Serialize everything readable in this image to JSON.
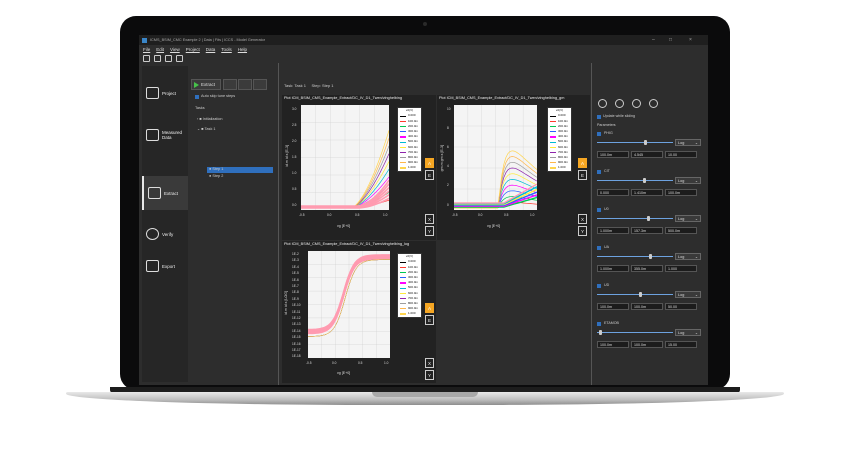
{
  "window": {
    "title": "ICMS_BSIM_CMC Example 2 | Data | Fits | ICCS - Model Generator"
  },
  "menu": [
    "File",
    "Edit",
    "View",
    "Project",
    "Data",
    "Tools",
    "Help"
  ],
  "nav": [
    {
      "label": "Project",
      "icon": "project-icon"
    },
    {
      "label": "Measured Data",
      "icon": "table-icon"
    },
    {
      "label": "Extract",
      "icon": "extract-icon"
    },
    {
      "label": "Verify",
      "icon": "check-circle-icon"
    },
    {
      "label": "Export",
      "icon": "export-table-icon"
    }
  ],
  "tasks_panel": {
    "extract_label": "Extract",
    "auto_skip": "Auto skip tune steps",
    "tasks_header": "Tasks",
    "items": [
      "Initialization",
      "Task 1",
      "Step 1",
      "Step 2"
    ]
  },
  "breadcrumb": {
    "task": "Task: Task 1",
    "step": "Step: Step 1"
  },
  "plots": [
    {
      "title": "Plot ICM_BSIM_CMS_Example_Extract/DC_IV_D1_Twen/vlnghelbing",
      "ylabel": "id.m id.s [E-3]",
      "xlabel": "vg [E+0]",
      "yticks": [
        "3.0",
        "2.5",
        "2.0",
        "1.5",
        "1.0",
        "0.5",
        "0.0"
      ],
      "xticks": [
        "-0.5",
        "0.0",
        "0.5",
        "1.0"
      ]
    },
    {
      "title": "Plot ICM_BSIM_CMS_Example_Extract/DC_IV_D1_Twen/vlnghelbing_gm",
      "ylabel": "gm.m gm.s [E-3]",
      "xlabel": "vg [E+0]",
      "yticks": [
        "10",
        "8",
        "6",
        "4",
        "2",
        "0"
      ],
      "xticks": [
        "-0.5",
        "0.0",
        "0.5",
        "1.0"
      ]
    },
    {
      "title": "Plot ICM_BSIM_CMS_Example_Extract/DC_IV_D1_Twen/vlnghelbing_log",
      "ylabel": "id.m id.s [LOG]",
      "xlabel": "vg [E+0]",
      "yticks": [
        "1E-2",
        "1E-3",
        "1E-4",
        "1E-5",
        "1E-6",
        "1E-7",
        "1E-8",
        "1E-9",
        "1E-10",
        "1E-11",
        "1E-12",
        "1E-13",
        "1E-14",
        "1E-15",
        "1E-16",
        "1E-17",
        "1E-18"
      ],
      "xticks": [
        "-0.5",
        "0.0",
        "0.5",
        "1.0"
      ]
    }
  ],
  "legend": {
    "header": "vd(V)",
    "entries": [
      "0.000",
      "100.0m",
      "200.0m",
      "300.0m",
      "400.0m",
      "500.0m",
      "600.0m",
      "700.0m",
      "800.0m",
      "900.0m",
      "1.000"
    ]
  },
  "side_buttons": {
    "a": "A",
    "e": "E",
    "x": "X",
    "y": "Y"
  },
  "parameters_panel": {
    "update_label": "Update while sliding",
    "parameters_label": "Parameters",
    "params": [
      {
        "name": "PHIG",
        "scale": "Log",
        "values": [
          "100.0m",
          "4.545",
          "10.00"
        ],
        "level": 0.62
      },
      {
        "name": "CIT",
        "scale": "Log",
        "values": [
          "0.000",
          "1.410m",
          "100.0m"
        ],
        "level": 0.6
      },
      {
        "name": "U0",
        "scale": "Log",
        "values": [
          "1.000m",
          "157.3m",
          "500.0m"
        ],
        "level": 0.66
      },
      {
        "name": "UA",
        "scale": "Log",
        "values": [
          "1.000m",
          "355.0m",
          "1.000"
        ],
        "level": 0.69
      },
      {
        "name": "UD",
        "scale": "Log",
        "values": [
          "100.0m",
          "100.0m",
          "50.00"
        ],
        "level": 0.55
      },
      {
        "name": "ETAMOB",
        "scale": "Log",
        "values": [
          "100.0m",
          "100.0m",
          "15.00"
        ],
        "level": 0.02
      }
    ]
  },
  "colors": {
    "accent": "#f5a623",
    "selection": "#2f6fbd"
  },
  "series_colors": [
    "#000000",
    "#ff3b30",
    "#00c853",
    "#2962ff",
    "#ff00ff",
    "#00bcd4",
    "#ffeb3b",
    "#8e24aa",
    "#9e9e9e",
    "#ffb74d",
    "#ffd54f"
  ]
}
